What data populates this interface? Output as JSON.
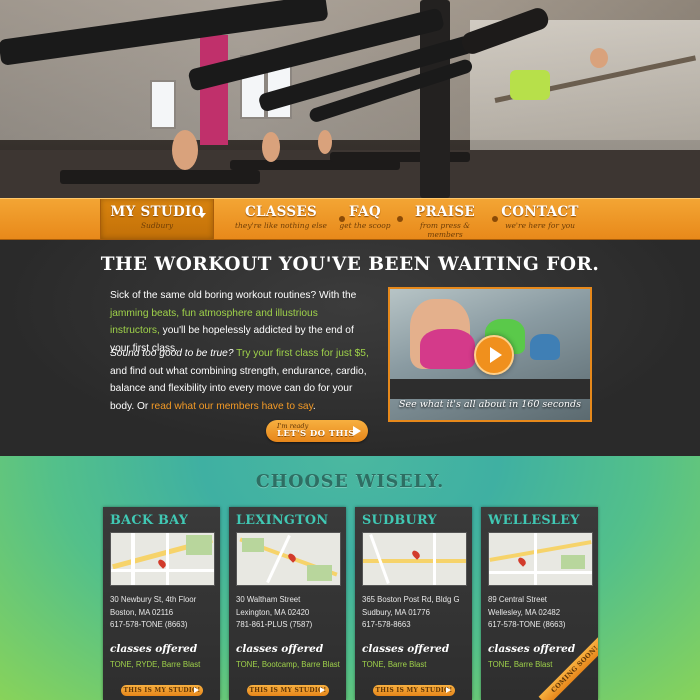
{
  "nav": {
    "items": [
      {
        "label": "MY STUDIO",
        "sub": "Sudbury"
      },
      {
        "label": "CLASSES",
        "sub": "they're like nothing else"
      },
      {
        "label": "FAQ",
        "sub": "get the scoop"
      },
      {
        "label": "PRAISE",
        "sub": "from press & members"
      },
      {
        "label": "CONTACT",
        "sub": "we're here for you"
      }
    ]
  },
  "intro": {
    "headline": "THE WORKOUT YOU'VE BEEN WAITING FOR.",
    "p1_a": "Sick of the same old boring workout routines? With the ",
    "p1_link": "jamming beats, fun atmosphere and illustrious instructors,",
    "p1_b": " you'll be hopelessly addicted by the end of your first class.",
    "p2_a": "Sound too good to be true?",
    "p2_link1": " Try your first class for just $5,",
    "p2_b": " and find out what combining strength, endurance, cardio, balance and flexibility into every move can do for your body. Or ",
    "p2_link2": "read what our members have to say",
    "p2_c": ".",
    "video_caption": "See what it's all about in 160 seconds",
    "cta_small": "I'm ready",
    "cta_big": "LET'S DO THIS"
  },
  "locations": {
    "heading": "CHOOSE WISELY.",
    "classes_heading": "classes offered",
    "button_label": "THIS IS MY STUDIO!",
    "coming_soon": "COMING SOON!",
    "cards": [
      {
        "name": "BACK BAY",
        "addr1": "30 Newbury St, 4th Floor",
        "addr2": "Boston, MA 02116",
        "phone": "617-578-TONE (8663)",
        "classes": "TONE, RYDE, Barre Blast"
      },
      {
        "name": "LEXINGTON",
        "addr1": "30 Waltham Street",
        "addr2": "Lexington, MA 02420",
        "phone": "781-861-PLUS (7587)",
        "classes": "TONE, Bootcamp, Barre Blast"
      },
      {
        "name": "SUDBURY",
        "addr1": "365 Boston Post Rd, Bldg G",
        "addr2": "Sudbury, MA 01776",
        "phone": "617-578-8663",
        "classes": "TONE, Barre Blast"
      },
      {
        "name": "WELLESLEY",
        "addr1": "89 Central Street",
        "addr2": "Wellesley, MA 02482",
        "phone": "617-578-TONE (8663)",
        "classes": "TONE, Barre Blast"
      }
    ]
  },
  "colors": {
    "accent": "#e8891a",
    "teal": "#40c8b4",
    "green_text": "#9fd24a"
  }
}
